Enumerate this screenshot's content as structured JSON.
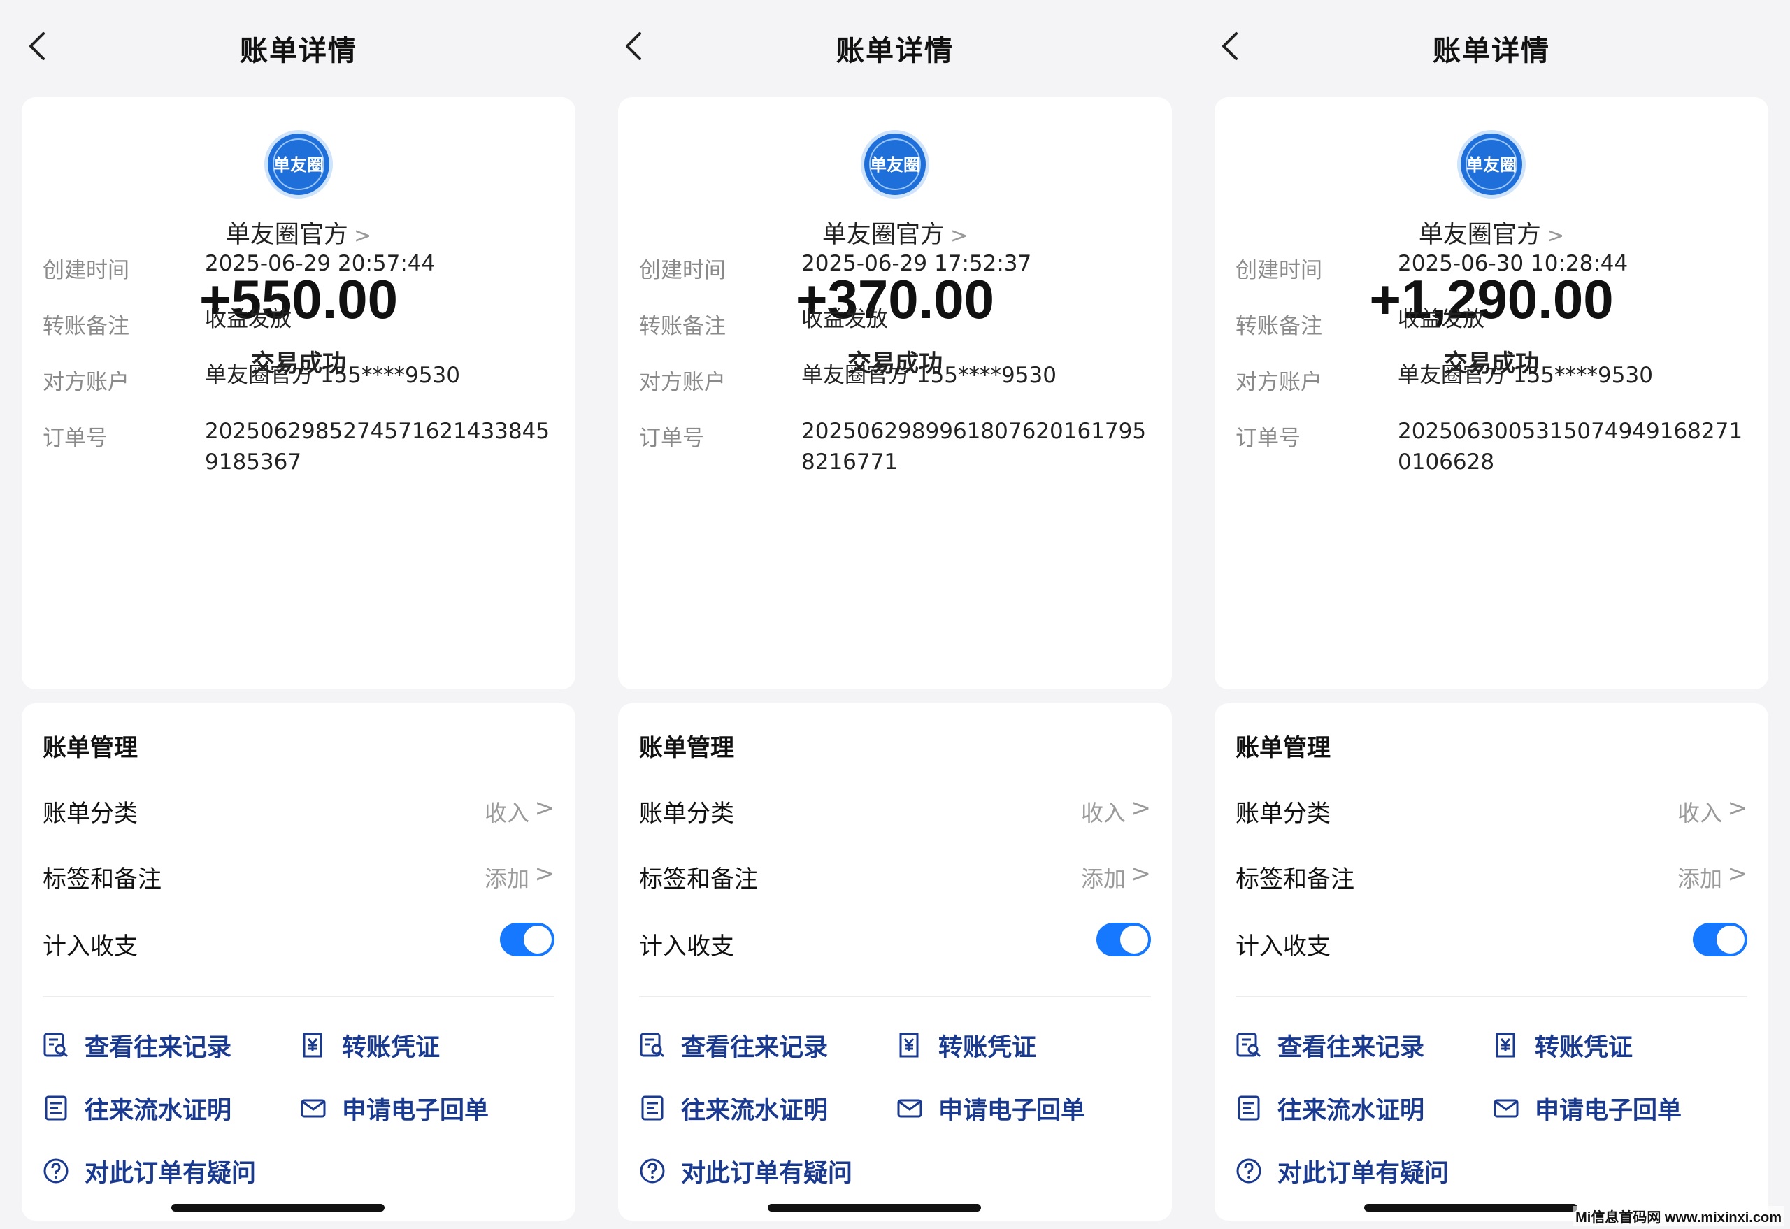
{
  "header": {
    "title": "账单详情"
  },
  "receipts": [
    {
      "payee": "单友圈官方",
      "amount": "+550.00",
      "status": "交易成功",
      "details": [
        {
          "label": "创建时间",
          "value": "2025-06-29 20:57:44"
        },
        {
          "label": "转账备注",
          "value": "收益发放"
        },
        {
          "label": "对方账户",
          "value": "单友圈官方 155****9530"
        },
        {
          "label": "订单号",
          "value": "20250629852745716214338459185367"
        }
      ]
    },
    {
      "payee": "单友圈官方",
      "amount": "+370.00",
      "status": "交易成功",
      "details": [
        {
          "label": "创建时间",
          "value": "2025-06-29 17:52:37"
        },
        {
          "label": "转账备注",
          "value": "收益发放"
        },
        {
          "label": "对方账户",
          "value": "单友圈官方 155****9530"
        },
        {
          "label": "订单号",
          "value": "20250629899618076201617958216771"
        }
      ]
    },
    {
      "payee": "单友圈官方",
      "amount": "+1,290.00",
      "status": "交易成功",
      "details": [
        {
          "label": "创建时间",
          "value": "2025-06-30 10:28:44"
        },
        {
          "label": "转账备注",
          "value": "收益发放"
        },
        {
          "label": "对方账户",
          "value": "单友圈官方 155****9530"
        },
        {
          "label": "订单号",
          "value": "20250630053150749491682710106628"
        }
      ]
    }
  ],
  "logo_text": "单友圈",
  "management": {
    "title": "账单管理",
    "category_label": "账单分类",
    "category_value": "收入",
    "tags_label": "标签和备注",
    "tags_value": "添加",
    "include_label": "计入收支",
    "include_on": true
  },
  "links": {
    "history": "查看往来记录",
    "voucher": "转账凭证",
    "statement": "往来流水证明",
    "receipt": "申请电子回单",
    "question": "对此订单有疑问"
  },
  "watermark": "Mi信息首码网 www.mixinxi.com",
  "colors": {
    "accent": "#1677ff",
    "link": "#1a3a8f",
    "logo": "#1e6fd9"
  }
}
